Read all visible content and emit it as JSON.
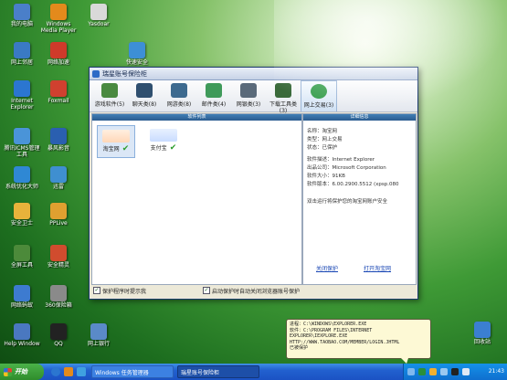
{
  "desktop": {
    "icons": [
      {
        "label": "我的电脑",
        "color": "#4a7fc9"
      },
      {
        "label": "Windows Media Player",
        "color": "#e38a1c"
      },
      {
        "label": "Yasdoar",
        "color": "#d9d9d9"
      },
      {
        "label": "网上邻居",
        "color": "#3a7ac4"
      },
      {
        "label": "网络加速",
        "color": "#cf3a2a"
      },
      {
        "label": "快速安全",
        "color": "#3d8fd6"
      },
      {
        "label": "Internet Explorer",
        "color": "#2b76d0"
      },
      {
        "label": "Foxmail",
        "color": "#d0402f"
      },
      {
        "label": "腾讯ICMS管理工具",
        "color": "#4a94d8"
      },
      {
        "label": "暴风影音",
        "color": "#2a5fb0"
      },
      {
        "label": "系统优化大师",
        "color": "#2f88d4"
      },
      {
        "label": "迅雷",
        "color": "#3f8fd0"
      },
      {
        "label": "安全卫士",
        "color": "#e8b33b"
      },
      {
        "label": "PPLive",
        "color": "#e0a030"
      },
      {
        "label": "全屏工具",
        "color": "#4c8a3a"
      },
      {
        "label": "安全精灵",
        "color": "#d04c2e"
      },
      {
        "label": "网络蚂蚁",
        "color": "#3d7bd0"
      },
      {
        "label": "360保险箱",
        "color": "#8a8a8a"
      },
      {
        "label": "Help Window",
        "color": "#4a78c0"
      },
      {
        "label": "QQ",
        "color": "#222222"
      },
      {
        "label": "网上银行",
        "color": "#5a8ac8"
      },
      {
        "label": "回收站",
        "color": "#3b7fd0"
      }
    ]
  },
  "window": {
    "title": "瑞星账号保险柜",
    "toolbar": [
      {
        "label": "游戏软件(5)",
        "color": "#4a8a40"
      },
      {
        "label": "聊天类(8)",
        "color": "#2f4f6f"
      },
      {
        "label": "网游类(8)",
        "color": "#3d6a8f"
      },
      {
        "label": "邮件类(4)",
        "color": "#3f9a5a"
      },
      {
        "label": "网银类(3)",
        "color": "#5a6a7a"
      },
      {
        "label": "下载工具类(3)",
        "color": "#3a6a3a"
      },
      {
        "label": "网上交易(3)",
        "color": "#3aa050"
      }
    ],
    "left_pane_title": "软件列表",
    "right_pane_title": "详细信息",
    "items": [
      {
        "label": "淘宝网",
        "logo": "taobao"
      },
      {
        "label": "支付宝",
        "logo": "alipay"
      }
    ],
    "details": {
      "name": "名称：淘宝网",
      "type": "类型：网上交易",
      "status": "状态：已保护",
      "desc": "软件描述：Internet Explorer",
      "company": "出品公司：Microsoft Corporation",
      "size": "软件大小：91KB",
      "version": "软件版本：6.00.2900.5512 (xpsp.080",
      "note": "双击运行将保护您的淘宝网账户安全",
      "link_left": "关闭保护",
      "link_right": "打开淘宝网"
    },
    "options": [
      {
        "label": "保护程序时提示我",
        "checked": true
      },
      {
        "label": "启动保护时自动关闭浏览器账号保护",
        "checked": true
      }
    ]
  },
  "balloon": {
    "lines": [
      "进程：C:\\WINDOWS\\EXPLORER.EXE",
      "软件：C:\\PROGRAM FILES\\INTERNET",
      "EXPLORER\\IEXPLORE.EXE",
      "HTTP://WWW.TAOBAO.COM/MEMBER/LOGIN.JHTML",
      "已被保护"
    ]
  },
  "taskbar": {
    "start_label": "开始",
    "tasks": [
      {
        "label": "Windows 任务管理器",
        "active": false
      },
      {
        "label": "瑞星账号保险柜",
        "active": true
      }
    ],
    "clock": "21:43"
  }
}
